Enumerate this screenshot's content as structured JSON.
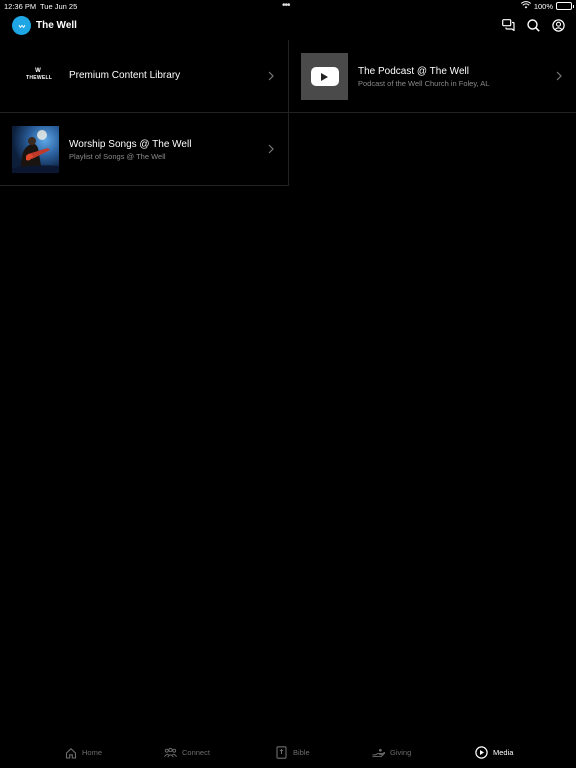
{
  "status": {
    "time": "12:36 PM",
    "date": "Tue Jun 25",
    "battery": "100%",
    "battery_level": 1.0
  },
  "header": {
    "title": "The Well",
    "icons": [
      "chat-icon",
      "search-icon",
      "account-icon"
    ]
  },
  "cards": [
    {
      "title": "Premium Content Library",
      "logo_text_top": "W",
      "logo_text_bottom": "THEWELL"
    },
    {
      "title": "The Podcast @ The Well",
      "subtitle": "Podcast of the Well Church in Foley, AL"
    },
    {
      "title": "Worship Songs @ The Well",
      "subtitle": "Playlist of Songs @ The Well"
    }
  ],
  "tabs": [
    {
      "label": "Home",
      "icon": "home-icon",
      "active": false
    },
    {
      "label": "Connect",
      "icon": "people-icon",
      "active": false
    },
    {
      "label": "Bible",
      "icon": "bible-icon",
      "active": false
    },
    {
      "label": "Giving",
      "icon": "giving-icon",
      "active": false
    },
    {
      "label": "Media",
      "icon": "play-circle-icon",
      "active": true
    }
  ],
  "colors": {
    "accent": "#1ea7e4",
    "background": "#000000",
    "inactive_tab": "#6d6d6d",
    "subtitle": "#8a8a8a"
  }
}
